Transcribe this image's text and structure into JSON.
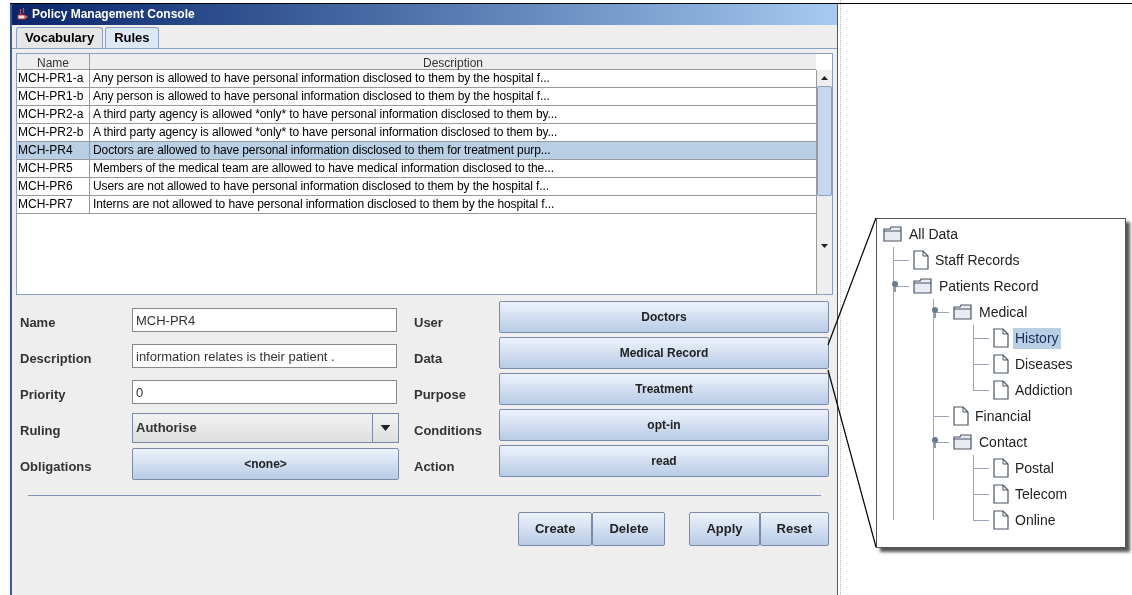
{
  "window": {
    "title": "Policy Management Console"
  },
  "tabs": [
    {
      "label": "Vocabulary",
      "selected": false
    },
    {
      "label": "Rules",
      "selected": true
    }
  ],
  "table": {
    "columns": [
      "Name",
      "Description"
    ],
    "rows": [
      {
        "name": "MCH-PR1-a",
        "description": "Any person is allowed to have personal information disclosed to them by the hospital f...",
        "selected": false
      },
      {
        "name": "MCH-PR1-b",
        "description": "Any person is allowed to have personal information disclosed to them by the hospital f...",
        "selected": false
      },
      {
        "name": "MCH-PR2-a",
        "description": "A third party agency is allowed *only* to have personal information disclosed to them by...",
        "selected": false
      },
      {
        "name": "MCH-PR2-b",
        "description": "A third party agency is allowed *only* to have personal information disclosed to them by...",
        "selected": false
      },
      {
        "name": "MCH-PR4",
        "description": "Doctors are allowed to have personal information disclosed to them for treatment purp...",
        "selected": true
      },
      {
        "name": "MCH-PR5",
        "description": "Members of the medical team are allowed to have medical information disclosed to the...",
        "selected": false
      },
      {
        "name": "MCH-PR6",
        "description": "Users are not allowed to have personal information disclosed to them by the hospital f...",
        "selected": false
      },
      {
        "name": "MCH-PR7",
        "description": "Interns are not allowed to have personal information disclosed to them by the hospital f...",
        "selected": false
      }
    ]
  },
  "form": {
    "left": [
      {
        "kind": "text",
        "label": "Name",
        "value": "MCH-PR4"
      },
      {
        "kind": "text",
        "label": "Description",
        "value": "information relates is their patient ."
      },
      {
        "kind": "text",
        "label": "Priority",
        "value": "0"
      },
      {
        "kind": "combo",
        "label": "Ruling",
        "value": "Authorise"
      },
      {
        "kind": "button",
        "label": "Obligations",
        "value": "<none>"
      }
    ],
    "right": [
      {
        "label": "User",
        "value": "Doctors"
      },
      {
        "label": "Data",
        "value": "Medical Record"
      },
      {
        "label": "Purpose",
        "value": "Treatment"
      },
      {
        "label": "Conditions",
        "value": "opt-in"
      },
      {
        "label": "Action",
        "value": "read"
      }
    ]
  },
  "buttons": [
    [
      "Create",
      "Delete"
    ],
    [
      "Apply",
      "Reset"
    ]
  ],
  "tree": [
    {
      "label": "All Data",
      "kind": "folder",
      "selected": false,
      "children": [
        {
          "label": "Staff Records",
          "kind": "file",
          "selected": false
        },
        {
          "label": "Patients Record",
          "kind": "folder",
          "selected": false,
          "expanded": true,
          "children": [
            {
              "label": "Medical",
              "kind": "folder",
              "selected": false,
              "expanded": true,
              "children": [
                {
                  "label": "History",
                  "kind": "file",
                  "selected": true
                },
                {
                  "label": "Diseases",
                  "kind": "file",
                  "selected": false
                },
                {
                  "label": "Addiction",
                  "kind": "file",
                  "selected": false
                }
              ]
            },
            {
              "label": "Financial",
              "kind": "file",
              "selected": false
            },
            {
              "label": "Contact",
              "kind": "folder",
              "selected": false,
              "expanded": true,
              "children": [
                {
                  "label": "Postal",
                  "kind": "file",
                  "selected": false
                },
                {
                  "label": "Telecom",
                  "kind": "file",
                  "selected": false
                },
                {
                  "label": "Online",
                  "kind": "file",
                  "selected": false
                }
              ]
            }
          ]
        }
      ]
    }
  ]
}
